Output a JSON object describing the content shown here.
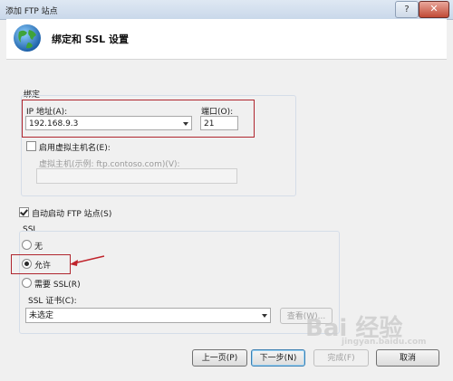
{
  "window": {
    "title": "添加 FTP 站点",
    "help_glyph": "?",
    "close_glyph": "✕"
  },
  "header": {
    "title": "绑定和 SSL 设置",
    "icon": "globe-icon"
  },
  "binding": {
    "group_label": "绑定",
    "ip_label": "IP 地址(A):",
    "ip_value": "192.168.9.3",
    "port_label": "端口(O):",
    "port_value": "21",
    "virtual_host_checkbox_label": "启用虚拟主机名(E):",
    "virtual_host_checked": false,
    "virtual_host_label": "虚拟主机(示例: ftp.contoso.com)(V):",
    "virtual_host_value": ""
  },
  "autostart": {
    "label": "自动启动 FTP 站点(S)",
    "checked": true
  },
  "ssl": {
    "group_label": "SSL",
    "option_none": "无",
    "option_allow": "允许",
    "option_require": "需要 SSL(R)",
    "selected": "允许",
    "cert_label": "SSL 证书(C):",
    "cert_value": "未选定",
    "view_button": "查看(W)..."
  },
  "footer": {
    "prev": "上一页(P)",
    "next": "下一步(N)",
    "finish": "完成(F)",
    "cancel": "取消"
  },
  "watermark": {
    "logo": "Bai 经验",
    "url": "jingyan.baidu.com"
  },
  "colors": {
    "highlight": "#b0262e",
    "default_button": "#3c7fb1"
  }
}
